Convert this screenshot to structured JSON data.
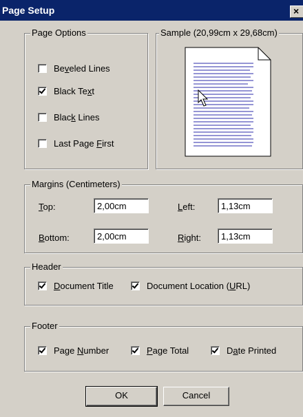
{
  "window": {
    "title": "Page Setup",
    "close_glyph": "×"
  },
  "page_options": {
    "legend": "Page Options",
    "items": [
      {
        "label_pre": "Be",
        "label_key": "v",
        "label_post": "eled Lines",
        "checked": false
      },
      {
        "label_pre": "Black Te",
        "label_key": "x",
        "label_post": "t",
        "checked": true
      },
      {
        "label_pre": "Blac",
        "label_key": "k",
        "label_post": " Lines",
        "checked": false
      },
      {
        "label_pre": "Last Page ",
        "label_key": "F",
        "label_post": "irst",
        "checked": false
      }
    ]
  },
  "sample": {
    "legend": "Sample (20,99cm x 29,68cm)",
    "icon": "page-preview-icon",
    "cursor": "arrow-cursor-icon"
  },
  "margins": {
    "legend": "Margins (Centimeters)",
    "top": {
      "key": "T",
      "rest": "op:",
      "value": "2,00cm"
    },
    "bottom": {
      "key": "B",
      "rest": "ottom:",
      "value": "2,00cm"
    },
    "left": {
      "key": "L",
      "rest": "eft:",
      "value": "1,13cm"
    },
    "right": {
      "key": "R",
      "rest": "ight:",
      "value": "1,13cm"
    }
  },
  "header": {
    "legend": "Header",
    "items": [
      {
        "label_pre": "",
        "label_key": "D",
        "label_post": "ocument Title",
        "checked": true
      },
      {
        "label_pre": "Document Location (",
        "label_key": "U",
        "label_post": "RL)",
        "checked": true
      }
    ]
  },
  "footer": {
    "legend": "Footer",
    "items": [
      {
        "label_pre": "Page ",
        "label_key": "N",
        "label_post": "umber",
        "checked": true
      },
      {
        "label_pre": "",
        "label_key": "P",
        "label_post": "age Total",
        "checked": true
      },
      {
        "label_pre": "D",
        "label_key": "a",
        "label_post": "te Printed",
        "checked": true
      }
    ]
  },
  "buttons": {
    "ok": "OK",
    "cancel": "Cancel"
  }
}
